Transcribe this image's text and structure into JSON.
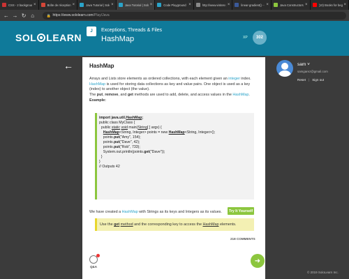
{
  "browser": {
    "tabs": [
      {
        "title": "CSS - 2 background-im...",
        "color": "#cc3333",
        "active": false
      },
      {
        "title": "Boîte de réception - ...",
        "color": "#d44638",
        "active": false
      },
      {
        "title": "Java Tutorial | SoloLe...",
        "color": "#2aa3c9",
        "active": false
      },
      {
        "title": "Java Tutorial | SoloLe...",
        "color": "#2aa3c9",
        "active": true
      },
      {
        "title": "Code Playground | So...",
        "color": "#2aa3c9",
        "active": false
      },
      {
        "title": "http://www.visites-3D...",
        "color": "#888888",
        "active": false
      },
      {
        "title": "linear-gradient() - CS...",
        "color": "#3b5998",
        "active": false
      },
      {
        "title": "Java Constructors | S...",
        "color": "#8cc63e",
        "active": false
      },
      {
        "title": "(10) Books for beginn...",
        "color": "#ff0000",
        "active": false
      }
    ],
    "url_host": "https://www.sololearn.com",
    "url_path": "/Play/Java"
  },
  "header": {
    "logo_left": "SOL",
    "logo_right": "LEARN",
    "module_title": "Exceptions, Threads & Files",
    "lesson_title": "HashMap",
    "xp_label": "XP",
    "xp_value": "302"
  },
  "lesson": {
    "title": "HashMap",
    "p1_a": "Arrays and Lists store elements as ordered collections, with each element given an ",
    "p1_link": "integer",
    "p1_b": " index.",
    "p2_link": "HashMap",
    "p2_a": " is used for storing data collections as key and value pairs. One object is used as a key (index) to another object (the value).",
    "p3_a": "The ",
    "p3_put": "put",
    "p3_b": ", ",
    "p3_remove": "remove",
    "p3_c": ", and ",
    "p3_get": "get",
    "p3_d": " methods are used to add, delete, and access values in the ",
    "p3_link": "HashMap",
    "p3_e": ".",
    "example_label": "Example:",
    "code": {
      "l1_a": "import java.util.",
      "l1_b": "HashMap",
      "l1_c": ";",
      "l2": "public class MyClass {",
      "l3_a": "  public ",
      "l3_b": "static",
      "l3_c": " ",
      "l3_d": "void",
      "l3_e": " main(",
      "l3_f": "String",
      "l3_g": "[ ] args) {",
      "l4_a": "    ",
      "l4_b": "HashMap",
      "l4_c": "<String, Integer> points = new ",
      "l4_d": "HashMap",
      "l4_e": "<String, Integer>();",
      "l5_a": "    points.",
      "l5_b": "put",
      "l5_c": "(\"Amy\", 154);",
      "l6_a": "    points.",
      "l6_b": "put",
      "l6_c": "(\"Dave\", 42);",
      "l7_a": "    points.",
      "l7_b": "put",
      "l7_c": "(\"Rob\", 733);",
      "l8_a": "    System.out.println(points.",
      "l8_b": "get",
      "l8_c": "(\"Dave\"));",
      "l9": "  }",
      "l10": "}",
      "l11": "// Outputs 42"
    },
    "try_button": "Try It Yourself",
    "p4_a": "We have created a ",
    "p4_link": "HashMap",
    "p4_b": " with Strings as its keys and Integers as its values.",
    "note_a": "Use the ",
    "note_get": "get",
    "note_b": " ",
    "note_method": "method",
    "note_c": " and the corresponding key to access the ",
    "note_hashmap": "HashMap",
    "note_d": " elements.",
    "comments": "218 COMMENTS",
    "qa_label": "Q&A"
  },
  "user": {
    "name": "sam",
    "email": "samgarez@gmail.com",
    "reset": "Reset",
    "sep": "|",
    "signout": "Sign out"
  },
  "footer": {
    "copyright": "© 2019 SoloLearn Inc."
  },
  "colors": {
    "header_bg": "#0f7a9a",
    "link": "#2aa3c9",
    "accent_green": "#8cc63e",
    "note_bg": "#f3f0b3"
  }
}
